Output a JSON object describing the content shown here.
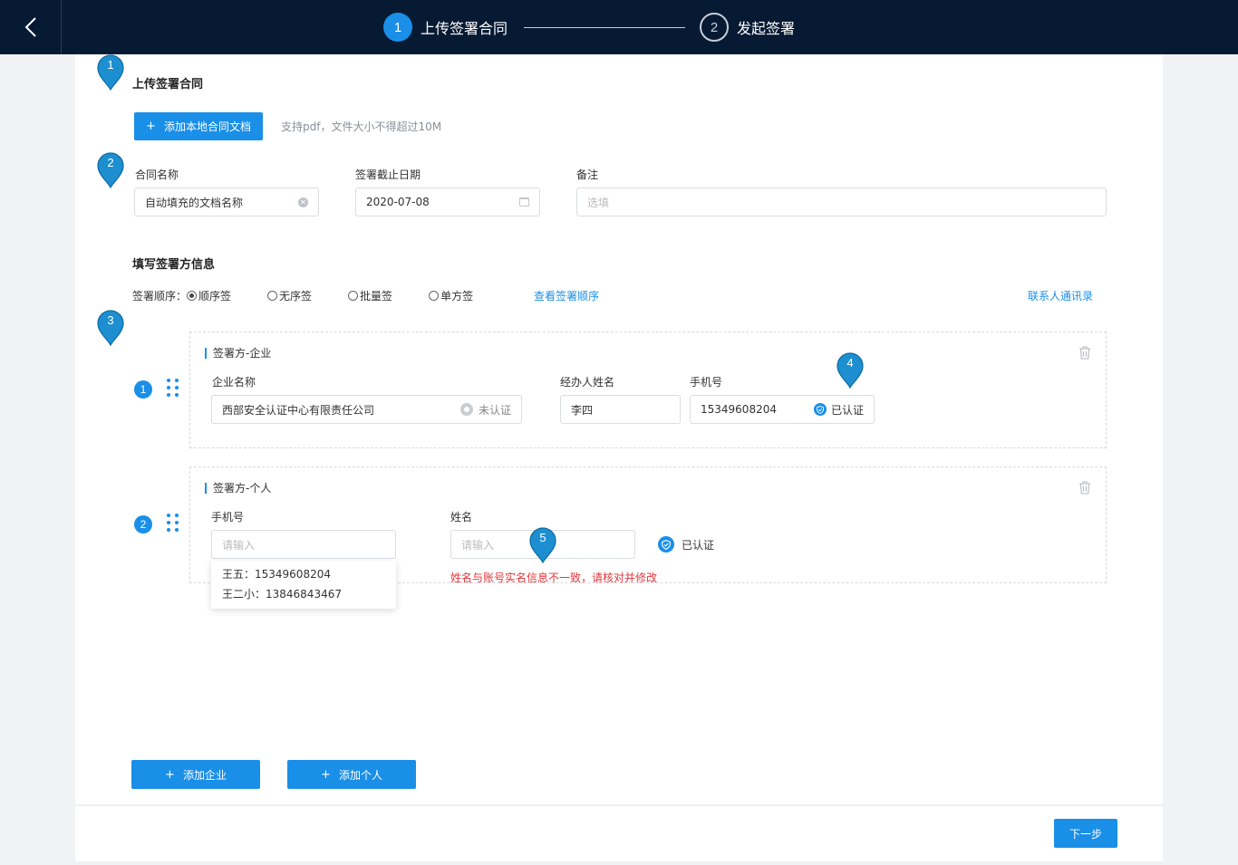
{
  "header": {
    "steps": [
      {
        "num": "1",
        "label": "上传签署合同"
      },
      {
        "num": "2",
        "label": "发起签署"
      }
    ]
  },
  "upload": {
    "title": "上传签署合同",
    "add_button": "添加本地合同文档",
    "hint": "支持pdf，文件大小不得超过10M"
  },
  "form": {
    "contract_name_label": "合同名称",
    "contract_name_value": "自动填充的文档名称",
    "deadline_label": "签署截止日期",
    "deadline_value": "2020-07-08",
    "remark_label": "备注",
    "remark_placeholder": "选填"
  },
  "signers": {
    "title": "填写签署方信息",
    "order_label": "签署顺序：",
    "order_options": [
      "顺序签",
      "无序签",
      "批量签",
      "单方签"
    ],
    "order_selected": "顺序签",
    "view_order_link": "查看签署顺序",
    "contacts_link": "联系人通讯录"
  },
  "card1": {
    "index": "1",
    "title": "签署方-企业",
    "company_label": "企业名称",
    "company_value": "西部安全认证中心有限责任公司",
    "company_status": "未认证",
    "handler_label": "经办人姓名",
    "handler_value": "李四",
    "phone_label": "手机号",
    "phone_value": "15349608204",
    "phone_status": "已认证"
  },
  "card2": {
    "index": "2",
    "title": "签署方-个人",
    "phone_label": "手机号",
    "phone_placeholder": "请输入",
    "name_label": "姓名",
    "name_placeholder": "请输入",
    "status": "已认证",
    "error": "姓名与账号实名信息不一致，请核对并修改",
    "suggestions": [
      "王五：15349608204",
      "王二小：13846843467"
    ]
  },
  "actions": {
    "add_company": "添加企业",
    "add_person": "添加个人",
    "next": "下一步"
  },
  "markers": [
    "1",
    "2",
    "3",
    "4",
    "5"
  ],
  "colors": {
    "accent": "#1a8fe8",
    "topbar": "#061a33",
    "error": "#e5363a",
    "marker": "#1d8fd0"
  }
}
